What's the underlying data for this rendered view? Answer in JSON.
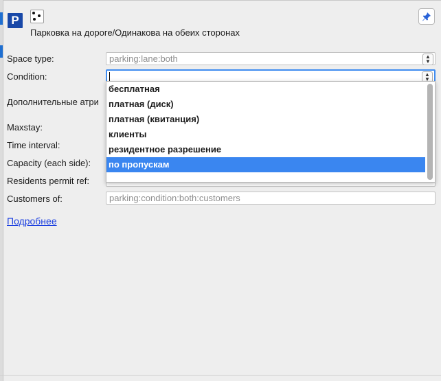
{
  "preset": {
    "icon_letter": "P",
    "title": "Парковка на дороге/Одинакова на обеих сторонах"
  },
  "icons": {
    "preset_icon": "parking-icon",
    "geometry_icon": "node-points-icon",
    "pin_icon": "pin-icon"
  },
  "fields": {
    "space_type": {
      "label": "Space type:",
      "value": "parking:lane:both"
    },
    "condition": {
      "label": "Condition:",
      "value": ""
    },
    "additional_attributes": {
      "label": "Дополнительные атри"
    },
    "maxstay": {
      "label": "Maxstay:"
    },
    "time_interval": {
      "label": "Time interval:"
    },
    "capacity": {
      "label": "Capacity (each side):"
    },
    "residents_permit": {
      "label": "Residents permit ref:"
    },
    "customers_of": {
      "label": "Customers of:",
      "placeholder": "parking:condition:both:customers"
    }
  },
  "condition_dropdown": {
    "options": [
      "бесплатная",
      "платная (диск)",
      "платная (квитанция)",
      "клиенты",
      "резидентное разрешение",
      "по пропускам"
    ],
    "selected_index": 5
  },
  "more_link": "Подробнее",
  "colors": {
    "preset_icon_bg": "#1848a8",
    "selection": "#3a86f0",
    "focus_ring": "#3f8cf0",
    "link": "#1a3ee0"
  }
}
